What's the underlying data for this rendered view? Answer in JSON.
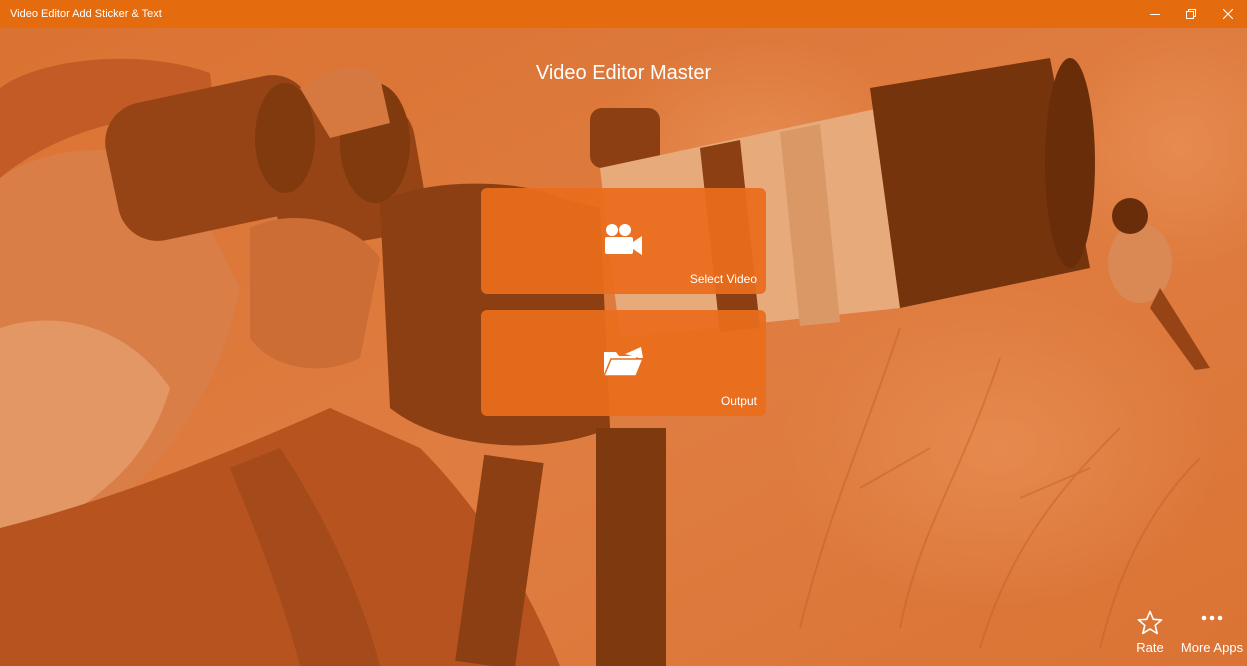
{
  "window": {
    "title": "Video Editor Add Sticker & Text",
    "controls": {
      "minimize_icon": "minimize-icon",
      "maximize_icon": "maximize-icon",
      "close_icon": "close-icon"
    }
  },
  "main": {
    "heading": "Video Editor Master",
    "tiles": [
      {
        "label": "Select Video",
        "icon": "video-camera-icon"
      },
      {
        "label": "Output",
        "icon": "folder-open-icon"
      }
    ]
  },
  "appbar": {
    "rate": {
      "label": "Rate",
      "icon": "star-icon"
    },
    "more": {
      "label": "More Apps",
      "icon": "more-dots-icon"
    }
  },
  "colors": {
    "accent": "#e56c0e",
    "tile": "#e96d1c",
    "overlay": "#d4621c",
    "text": "#ffffff"
  }
}
